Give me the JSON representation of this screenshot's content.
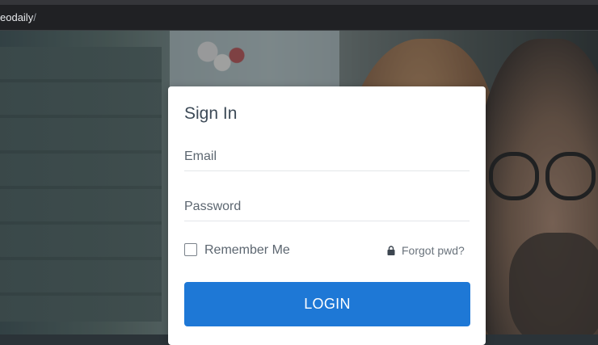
{
  "browser": {
    "url_visible": "eodaily",
    "url_suffix": "/"
  },
  "login": {
    "title": "Sign In",
    "email_label": "Email",
    "password_label": "Password",
    "remember_label": "Remember Me",
    "forgot_label": "Forgot pwd?",
    "login_button": "LOGIN",
    "remember_checked": false
  },
  "colors": {
    "primary": "#1e78d6",
    "card_bg": "#ffffff",
    "text": "#5c6670"
  },
  "icons": {
    "lock": "lock-icon"
  }
}
